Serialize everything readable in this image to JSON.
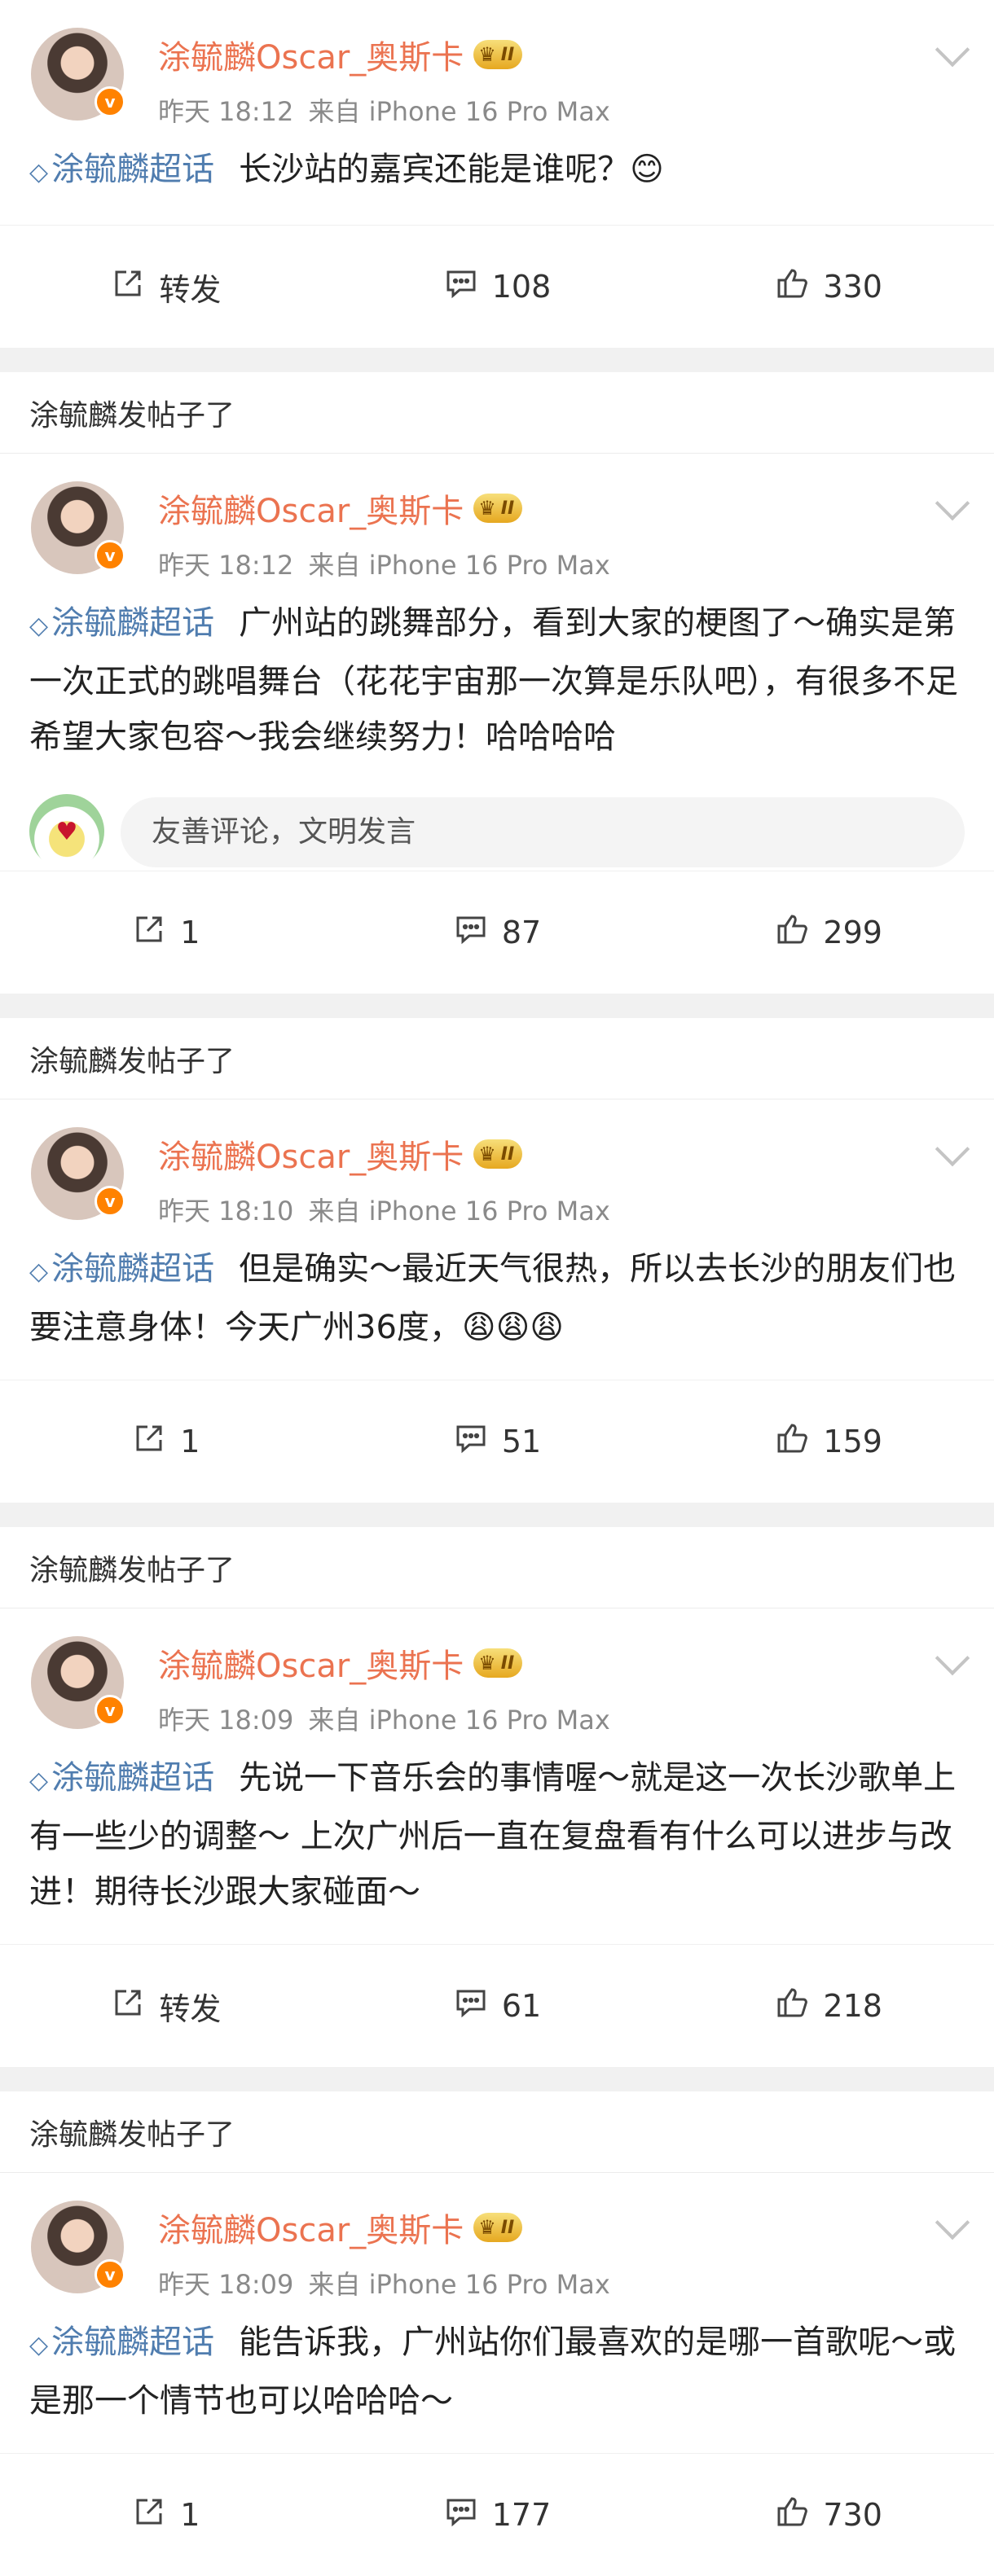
{
  "section_label": "涂毓麟发帖子了",
  "posts": [
    {
      "author": "涂毓麟Oscar_奥斯卡",
      "badge_level": "II",
      "time": "昨天 18:12",
      "source": "来自 iPhone 16 Pro Max",
      "topic": "涂毓麟超话",
      "text": "长沙站的嘉宾还能是谁呢？",
      "emoji": "😊",
      "show_comment_box": false,
      "actions": {
        "repost": "转发",
        "comments": "108",
        "likes": "330"
      }
    },
    {
      "author": "涂毓麟Oscar_奥斯卡",
      "badge_level": "II",
      "time": "昨天 18:12",
      "source": "来自 iPhone 16 Pro Max",
      "topic": "涂毓麟超话",
      "text": "广州站的跳舞部分，看到大家的梗图了～确实是第一次正式的跳唱舞台（花花宇宙那一次算是乐队吧），有很多不足希望大家包容～我会继续努力！哈哈哈哈",
      "emoji": "",
      "show_comment_box": true,
      "comment_placeholder": "友善评论，文明发言",
      "actions": {
        "repost": "1",
        "comments": "87",
        "likes": "299"
      }
    },
    {
      "author": "涂毓麟Oscar_奥斯卡",
      "badge_level": "II",
      "time": "昨天 18:10",
      "source": "来自 iPhone 16 Pro Max",
      "topic": "涂毓麟超话",
      "text": "但是确实～最近天气很热，所以去长沙的朋友们也要注意身体！今天广州36度，",
      "emoji": "😩😩😩",
      "show_comment_box": false,
      "actions": {
        "repost": "1",
        "comments": "51",
        "likes": "159"
      }
    },
    {
      "author": "涂毓麟Oscar_奥斯卡",
      "badge_level": "II",
      "time": "昨天 18:09",
      "source": "来自 iPhone 16 Pro Max",
      "topic": "涂毓麟超话",
      "text": "先说一下音乐会的事情喔～就是这一次长沙歌单上有一些少的调整～ 上次广州后一直在复盘看有什么可以进步与改进！期待长沙跟大家碰面～",
      "emoji": "",
      "show_comment_box": false,
      "actions": {
        "repost": "转发",
        "comments": "61",
        "likes": "218"
      }
    },
    {
      "author": "涂毓麟Oscar_奥斯卡",
      "badge_level": "II",
      "time": "昨天 18:09",
      "source": "来自 iPhone 16 Pro Max",
      "topic": "涂毓麟超话",
      "text": "能告诉我，广州站你们最喜欢的是哪一首歌呢～或是那一个情节也可以哈哈哈～",
      "emoji": "",
      "show_comment_box": false,
      "actions": {
        "repost": "1",
        "comments": "177",
        "likes": "730"
      }
    }
  ]
}
